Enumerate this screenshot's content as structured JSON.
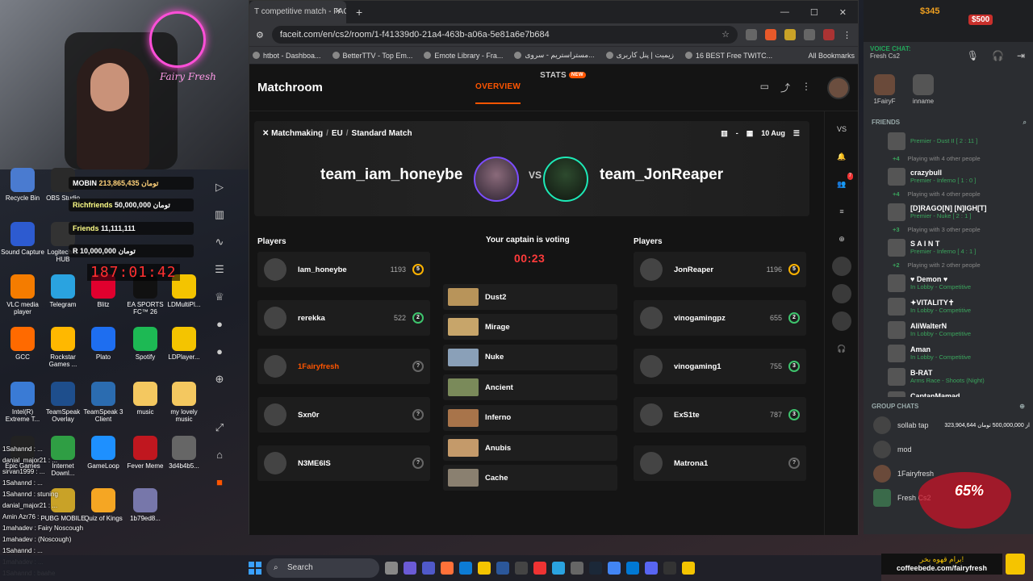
{
  "webcam": {
    "neon_text": "Fairy Fresh"
  },
  "desktop_icons": [
    {
      "label": "Recycle Bin",
      "color": "#4a7bd0"
    },
    {
      "label": "OBS Studio",
      "color": "#2a2a2a"
    },
    {
      "label": "Sound Capture",
      "color": "#2d5bd0"
    },
    {
      "label": "Logitech G HUB",
      "color": "#333"
    },
    {
      "label": "VLC media player",
      "color": "#f47c00"
    },
    {
      "label": "Telegram",
      "color": "#2aa3e0"
    },
    {
      "label": "Blitz",
      "color": "#e0002e"
    },
    {
      "label": "EA SPORTS FC™ 26",
      "color": "#111"
    },
    {
      "label": "LDMultiPl...",
      "color": "#f4c400"
    },
    {
      "label": "GCC",
      "color": "#ff6a00"
    },
    {
      "label": "Rockstar Games ...",
      "color": "#ffb800"
    },
    {
      "label": "Plato",
      "color": "#1e6ef0"
    },
    {
      "label": "Spotify",
      "color": "#1db954"
    },
    {
      "label": "LDPlayer...",
      "color": "#f4c400"
    },
    {
      "label": "Intel(R) Extreme T...",
      "color": "#3a7bd5"
    },
    {
      "label": "TeamSpeak Overlay",
      "color": "#1e4e8c"
    },
    {
      "label": "TeamSpeak 3 Client",
      "color": "#2b6cb0"
    },
    {
      "label": "music",
      "color": "#f4c860"
    },
    {
      "label": "my lovely music",
      "color": "#f4c860"
    },
    {
      "label": "Epic Games",
      "color": "#222"
    },
    {
      "label": "Internet Downl...",
      "color": "#2f9e44"
    },
    {
      "label": "GameLoop",
      "color": "#1e90ff"
    },
    {
      "label": "Fever Meme",
      "color": "#c0171f"
    },
    {
      "label": "3d4b4b5...",
      "color": "#666"
    },
    {
      "label": "PUBG MOBILE",
      "color": "#c9a227"
    },
    {
      "label": "Quiz of Kings",
      "color": "#f5a623"
    },
    {
      "label": "1b79ed8...",
      "color": "#77a"
    }
  ],
  "donations": {
    "top1": {
      "name": "MOBIN",
      "amount": "213,865,435 تومان"
    },
    "top2": {
      "name": "Richfriends",
      "amount": "50,000,000 تومان"
    },
    "top3": {
      "name": "Friends",
      "amount": "11,111,111"
    },
    "top4": {
      "name": "R",
      "amount": "10,000,000 تومان"
    },
    "clock": "187:01:42"
  },
  "chat_overlay": [
    "1Sahannd : ...",
    "danial_major21 : ...",
    "sirvan1999 : ...",
    "1Sahannd : ...",
    "1Sahannd : stuning",
    "danial_major21 : ...",
    "Amin Azr76 : ...",
    "1mahadev : Fairy Noscough",
    "1mahadev : (Noscough)",
    "1Sahannd : ...",
    "1mahadev : ...",
    "1Sahannd : baahe"
  ],
  "browser": {
    "tab_title": "T competitive match - FAC",
    "url": "faceit.com/en/cs2/room/1-f41339d0-21a4-463b-a06a-5e81a6e7b684",
    "bookmarks": [
      "htbot - Dashboa...",
      "BetterTTV - Top Em...",
      "Emote Library - Fra...",
      "مستراستریم - سروی...",
      "زیمیت | پنل کاربری",
      "16 BEST Free TWITC..."
    ],
    "all_bookmarks": "All Bookmarks"
  },
  "faceit": {
    "title": "Matchroom",
    "nav_overview": "OVERVIEW",
    "nav_stats": "STATS",
    "nav_new": "NEW",
    "breadcrumb": [
      "Matchmaking",
      "EU",
      "Standard Match"
    ],
    "date": "10 Aug",
    "team_a": "team_iam_honeybe",
    "team_b": "team_JonReaper",
    "vs": "VS",
    "players_label": "Players",
    "voting_title": "Your captain is voting",
    "timer": "00:23",
    "players_a": [
      {
        "name": "Iam_honeybe",
        "elo": "1193",
        "level": "5",
        "lvlclass": ""
      },
      {
        "name": "rerekka",
        "elo": "522",
        "level": "2",
        "lvlclass": "g"
      },
      {
        "name": "1Fairyfresh",
        "elo": "",
        "level": "?",
        "lvlclass": "q"
      },
      {
        "name": "Sxn0r",
        "elo": "",
        "level": "?",
        "lvlclass": "q"
      },
      {
        "name": "N3ME6IS",
        "elo": "",
        "level": "?",
        "lvlclass": "q"
      }
    ],
    "players_b": [
      {
        "name": "JonReaper",
        "elo": "1196",
        "level": "5",
        "lvlclass": ""
      },
      {
        "name": "vinogamingpz",
        "elo": "655",
        "level": "2",
        "lvlclass": "g"
      },
      {
        "name": "vinogaming1",
        "elo": "755",
        "level": "3",
        "lvlclass": "g"
      },
      {
        "name": "ExS1te",
        "elo": "787",
        "level": "3",
        "lvlclass": "g"
      },
      {
        "name": "Matrona1",
        "elo": "",
        "level": "?",
        "lvlclass": "q"
      }
    ],
    "maps": [
      "Dust2",
      "Mirage",
      "Nuke",
      "Ancient",
      "Inferno",
      "Anubis",
      "Cache"
    ],
    "right_vs": "VS",
    "notif_count": "7"
  },
  "discord": {
    "top_amount": "$345",
    "top_amount2": "$500",
    "voice_label": "VOICE CHAT:",
    "voice_channel": "Fresh Cs2",
    "voice_users": [
      "1FairyF",
      "inname"
    ],
    "friends_label": "FRIENDS",
    "friends": [
      {
        "name": "",
        "status": "Premier - Dust II [ 2 : 11 ]",
        "more": "+4",
        "more_text": "Playing with 4 other people"
      },
      {
        "name": "crazybull",
        "status": "Premier - Inferno [ 1 : 0 ]",
        "more": "+4",
        "more_text": "Playing with 4 other people"
      },
      {
        "name": "[D]RAGO[N] [N]IGH[T]",
        "status": "Premier - Nuke [ 2 : 1 ]",
        "more": "+3",
        "more_text": "Playing with 3 other people"
      },
      {
        "name": "S A I N T",
        "status": "Premier - Inferno [ 4 : 1 ]",
        "more": "+2",
        "more_text": "Playing with 2 other people"
      },
      {
        "name": "♥ Demon ♥",
        "status": "In Lobby - Competitive",
        "more": "",
        "more_text": ""
      },
      {
        "name": "✦VITALITY✝",
        "status": "In Lobby - Competitive",
        "more": "",
        "more_text": ""
      },
      {
        "name": "AliWalterN",
        "status": "In Lobby - Competitive",
        "more": "",
        "more_text": ""
      },
      {
        "name": "Aman",
        "status": "In Lobby - Competitive",
        "more": "",
        "more_text": ""
      },
      {
        "name": "B-RAT",
        "status": "Arms Race - Shoots (Night)",
        "more": "",
        "more_text": ""
      },
      {
        "name": "CaptanMamad",
        "status": "In Lobby - Competitive",
        "more": "",
        "more_text": ""
      }
    ],
    "group_label": "GROUP CHATS",
    "groups": [
      "sollab tap",
      "mod",
      "1Fairyfresh",
      "Fresh Cs2"
    ],
    "group_extra": "323,904,644 از 500,000,000 تومان",
    "percent": "65%"
  },
  "coffee": {
    "line1": "برام قهوه بخر!",
    "line2": "coffeebede.com/fairyfresh"
  },
  "taskbar": {
    "search": "Search"
  }
}
